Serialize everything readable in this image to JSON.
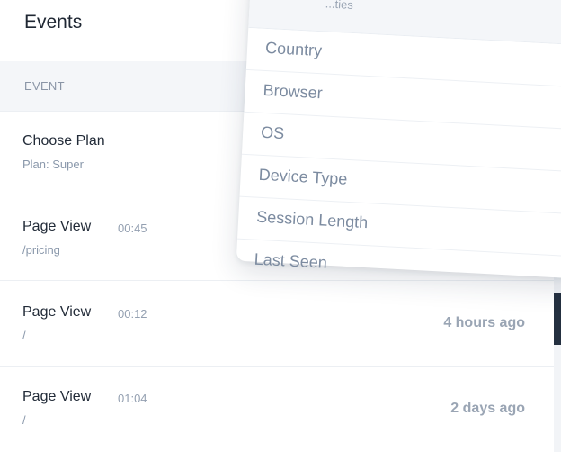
{
  "events_panel": {
    "title": "Events",
    "column_header": "EVENT",
    "rows": [
      {
        "name": "Choose Plan",
        "time": "",
        "detail": "Plan: Super",
        "ago": ""
      },
      {
        "name": "Page View",
        "time": "00:45",
        "detail": "/pricing",
        "ago": ""
      },
      {
        "name": "Page View",
        "time": "00:12",
        "detail": "/",
        "ago": "4 hours ago"
      },
      {
        "name": "Page View",
        "time": "01:04",
        "detail": "/",
        "ago": "2 days ago"
      }
    ]
  },
  "dropdown": {
    "header_partial": "...ties",
    "items": [
      "Country",
      "Browser",
      "OS",
      "Device Type",
      "Session Length",
      "Last Seen"
    ]
  }
}
